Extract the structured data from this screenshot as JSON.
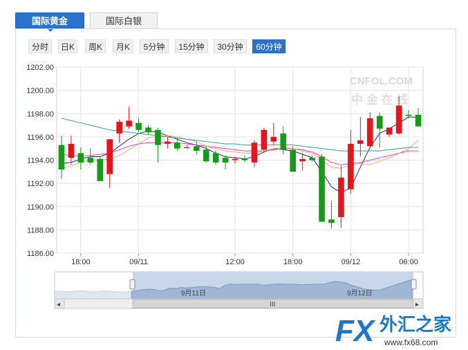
{
  "tabs": [
    {
      "label": "国际黄金",
      "active": true
    },
    {
      "label": "国际白银",
      "active": false
    }
  ],
  "periods": [
    "分时",
    "日K",
    "周K",
    "月K",
    "5分钟",
    "15分钟",
    "30分钟",
    "60分钟"
  ],
  "active_period": "60分钟",
  "watermark": {
    "brand": "CNFOL.COM",
    "cn": "中 金 在 线"
  },
  "logo": {
    "fx": "FX",
    "name": "外汇之家",
    "url": "www.fx68.com"
  },
  "navigator": {
    "labels": [
      "9月11日",
      "9月12日"
    ],
    "handle_glyph": "III",
    "left_arrow": "◂",
    "right_arrow": "▸"
  },
  "colors": {
    "up": "#e8141c",
    "down": "#169a1a",
    "ma1": "#1f2d6e",
    "ma2": "#ff33cc",
    "ma3": "#f0a868",
    "ma4": "#2e9fa6"
  },
  "chart_data": {
    "type": "candlestick",
    "ylim": [
      1186,
      1202
    ],
    "yticks": [
      "1202.00",
      "1200.00",
      "1198.00",
      "1196.00",
      "1194.00",
      "1192.00",
      "1190.00",
      "1188.00",
      "1186.00"
    ],
    "xticks": [
      {
        "label": "18:00",
        "index": 2
      },
      {
        "label": "09/11",
        "index": 8
      },
      {
        "label": "12:00",
        "index": 18
      },
      {
        "label": "18:00",
        "index": 24
      },
      {
        "label": "09/12",
        "index": 30
      },
      {
        "label": "06:00",
        "index": 36
      }
    ],
    "candles": [
      {
        "o": 1195.3,
        "h": 1196.1,
        "l": 1192.4,
        "c": 1193.2
      },
      {
        "o": 1194.2,
        "h": 1196.1,
        "l": 1193.6,
        "c": 1195.4
      },
      {
        "o": 1194.6,
        "h": 1195.1,
        "l": 1193.2,
        "c": 1193.8
      },
      {
        "o": 1194.2,
        "h": 1195.0,
        "l": 1193.6,
        "c": 1193.8
      },
      {
        "o": 1194.1,
        "h": 1194.3,
        "l": 1192.3,
        "c": 1192.2
      },
      {
        "o": 1192.8,
        "h": 1195.4,
        "l": 1191.6,
        "c": 1195.8
      },
      {
        "o": 1196.3,
        "h": 1197.5,
        "l": 1195.5,
        "c": 1197.3
      },
      {
        "o": 1196.9,
        "h": 1198.6,
        "l": 1196.7,
        "c": 1197.4
      },
      {
        "o": 1197.2,
        "h": 1197.6,
        "l": 1196.4,
        "c": 1196.6
      },
      {
        "o": 1196.8,
        "h": 1197.0,
        "l": 1196.2,
        "c": 1196.4
      },
      {
        "o": 1196.6,
        "h": 1196.8,
        "l": 1193.8,
        "c": 1195.3
      },
      {
        "o": 1195.4,
        "h": 1196.0,
        "l": 1195.0,
        "c": 1195.6
      },
      {
        "o": 1195.5,
        "h": 1195.9,
        "l": 1194.8,
        "c": 1195.0
      },
      {
        "o": 1195.1,
        "h": 1195.3,
        "l": 1195.0,
        "c": 1195.1
      },
      {
        "o": 1195.2,
        "h": 1195.6,
        "l": 1194.5,
        "c": 1194.8
      },
      {
        "o": 1194.9,
        "h": 1195.2,
        "l": 1193.8,
        "c": 1193.9
      },
      {
        "o": 1194.6,
        "h": 1194.8,
        "l": 1193.6,
        "c": 1193.8
      },
      {
        "o": 1194.2,
        "h": 1194.4,
        "l": 1193.2,
        "c": 1193.8
      },
      {
        "o": 1194.0,
        "h": 1194.3,
        "l": 1193.7,
        "c": 1194.1
      },
      {
        "o": 1194.1,
        "h": 1194.4,
        "l": 1193.8,
        "c": 1194.0
      },
      {
        "o": 1193.8,
        "h": 1195.7,
        "l": 1193.4,
        "c": 1195.5
      },
      {
        "o": 1194.9,
        "h": 1196.8,
        "l": 1194.8,
        "c": 1196.6
      },
      {
        "o": 1195.6,
        "h": 1197.2,
        "l": 1195.3,
        "c": 1196.0
      },
      {
        "o": 1196.3,
        "h": 1196.9,
        "l": 1194.5,
        "c": 1194.9
      },
      {
        "o": 1194.9,
        "h": 1195.2,
        "l": 1193.4,
        "c": 1193.0
      },
      {
        "o": 1193.9,
        "h": 1194.6,
        "l": 1193.1,
        "c": 1194.1
      },
      {
        "o": 1194.2,
        "h": 1194.4,
        "l": 1193.9,
        "c": 1194.0
      },
      {
        "o": 1194.3,
        "h": 1194.5,
        "l": 1192.5,
        "c": 1188.7
      },
      {
        "o": 1188.9,
        "h": 1190.5,
        "l": 1188.1,
        "c": 1188.6
      },
      {
        "o": 1189.1,
        "h": 1193.5,
        "l": 1188.2,
        "c": 1192.5
      },
      {
        "o": 1191.5,
        "h": 1196.6,
        "l": 1191.1,
        "c": 1195.4
      },
      {
        "o": 1195.4,
        "h": 1197.7,
        "l": 1194.3,
        "c": 1195.7
      },
      {
        "o": 1195.2,
        "h": 1198.1,
        "l": 1195.1,
        "c": 1197.6
      },
      {
        "o": 1197.8,
        "h": 1198.1,
        "l": 1195.1,
        "c": 1196.7
      },
      {
        "o": 1196.2,
        "h": 1196.8,
        "l": 1196.0,
        "c": 1196.8
      },
      {
        "o": 1196.3,
        "h": 1199.5,
        "l": 1196.2,
        "c": 1198.7
      },
      {
        "o": 1197.9,
        "h": 1198.3,
        "l": 1197.6,
        "c": 1197.8
      },
      {
        "o": 1197.9,
        "h": 1198.5,
        "l": 1197.0,
        "c": 1196.9
      }
    ],
    "ma": [
      {
        "color": "#1f2d6e",
        "values": [
          1193.7,
          1193.8,
          1194.1,
          1194.3,
          1194.3,
          1194.6,
          1195.2,
          1195.8,
          1196.3,
          1196.5,
          1196.4,
          1196.1,
          1195.8,
          1195.5,
          1195.3,
          1195.0,
          1194.6,
          1194.3,
          1194.2,
          1194.1,
          1194.3,
          1194.7,
          1195.0,
          1194.9,
          1194.8,
          1194.5,
          1194.2,
          1193.0,
          1191.7,
          1191.2,
          1191.6,
          1193.4,
          1195.1,
          1196.3,
          1196.7,
          1197.2,
          1197.7,
          1197.7
        ]
      },
      {
        "color": "#ff33cc",
        "values": [
          1194.5,
          1194.4,
          1194.3,
          1194.4,
          1194.5,
          1194.6,
          1194.9,
          1195.2,
          1195.4,
          1195.5,
          1195.5,
          1195.5,
          1195.5,
          1195.4,
          1195.3,
          1195.2,
          1195.1,
          1195.0,
          1194.9,
          1194.8,
          1194.8,
          1194.8,
          1194.9,
          1195.0,
          1195.0,
          1194.9,
          1194.7,
          1194.3,
          1193.8,
          1193.6,
          1193.7,
          1193.8,
          1194.0,
          1194.2,
          1194.4,
          1194.6,
          1194.8,
          1194.8
        ]
      },
      {
        "color": "#f0a868",
        "values": [
          1193.3,
          1193.5,
          1193.8,
          1194.0,
          1194.0,
          1194.1,
          1194.4,
          1194.9,
          1195.4,
          1195.9,
          1196.1,
          1196.1,
          1196.0,
          1195.8,
          1195.6,
          1195.2,
          1195.0,
          1194.8,
          1194.7,
          1194.6,
          1194.6,
          1194.8,
          1195.0,
          1195.1,
          1195.0,
          1194.8,
          1194.6,
          1194.0,
          1193.4,
          1193.3,
          1193.6,
          1193.7,
          1193.6,
          1193.9,
          1194.2,
          1194.6,
          1195.0,
          1195.7
        ]
      },
      {
        "color": "#2e9fa6",
        "values": [
          1197.6,
          1197.4,
          1197.2,
          1197.0,
          1196.8,
          1196.6,
          1196.5,
          1196.4,
          1196.3,
          1196.2,
          1196.1,
          1196.0,
          1195.9,
          1195.8,
          1195.7,
          1195.6,
          1195.5,
          1195.4,
          1195.4,
          1195.3,
          1195.3,
          1195.3,
          1195.3,
          1195.3,
          1195.3,
          1195.2,
          1195.1,
          1195.0,
          1194.9,
          1194.8,
          1194.8,
          1194.8,
          1194.8,
          1194.8,
          1194.9,
          1195.0,
          1195.1,
          1195.1
        ]
      }
    ],
    "overview": [
      0.72,
      0.73,
      0.73,
      0.74,
      0.72,
      0.7,
      0.72,
      0.74,
      0.73,
      0.71,
      0.72,
      0.73,
      0.75,
      0.74,
      0.72,
      0.7,
      0.66,
      0.64,
      0.65,
      0.7,
      0.68,
      0.6,
      0.62,
      0.58,
      0.6,
      0.58,
      0.56,
      0.55,
      0.56,
      0.57,
      0.62,
      0.5,
      0.45,
      0.47,
      0.46,
      0.46,
      0.46,
      0.46,
      0.5,
      0.48,
      0.46,
      0.45,
      0.46,
      0.46,
      0.47,
      0.48,
      0.47,
      0.46,
      0.46,
      0.45,
      0.4,
      0.36,
      0.38,
      0.41,
      0.5,
      0.55,
      0.62,
      0.66,
      0.68,
      0.67,
      0.62,
      0.55,
      0.48,
      0.42,
      0.35,
      0.3,
      0.28,
      0.3
    ]
  }
}
